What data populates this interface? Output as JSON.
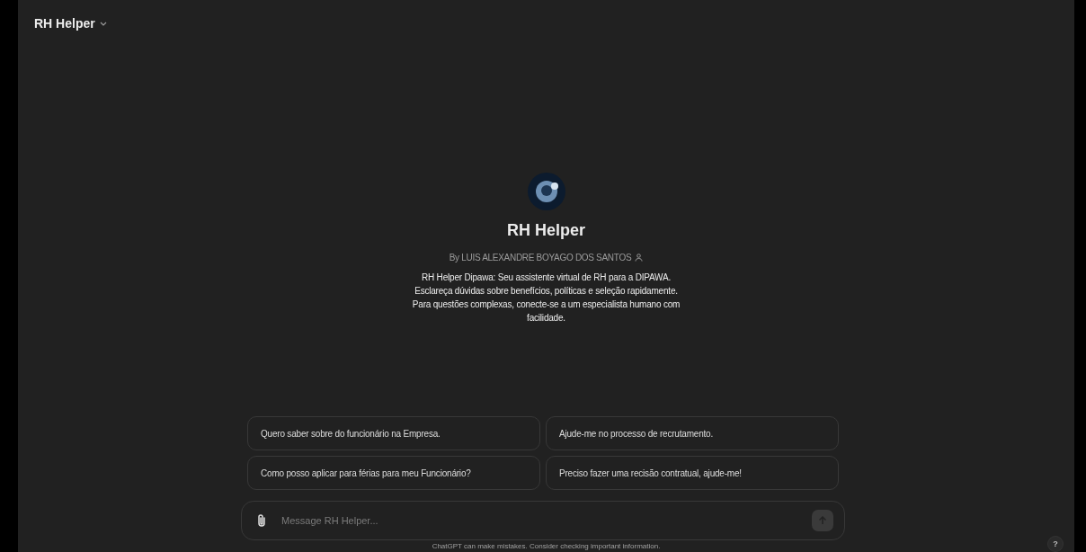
{
  "header": {
    "title": "RH Helper"
  },
  "profile": {
    "name": "RH Helper",
    "author": "By LUIS ALEXANDRE BOYAGO DOS SANTOS",
    "description": "RH Helper Dipawa: Seu assistente virtual de RH para a DIPAWA. Esclareça dúvidas sobre benefícios, políticas e seleção rapidamente. Para questões complexas, conecte-se a um especialista humano com facilidade."
  },
  "suggestions": [
    "Quero saber sobre do funcionário na Empresa.",
    "Ajude-me no processo de recrutamento.",
    "Como posso aplicar para férias para meu Funcionário?",
    "Preciso fazer uma recisão contratual, ajude-me!"
  ],
  "composer": {
    "placeholder": "Message RH Helper..."
  },
  "footer": "ChatGPT can make mistakes. Consider checking important information.",
  "help": "?"
}
